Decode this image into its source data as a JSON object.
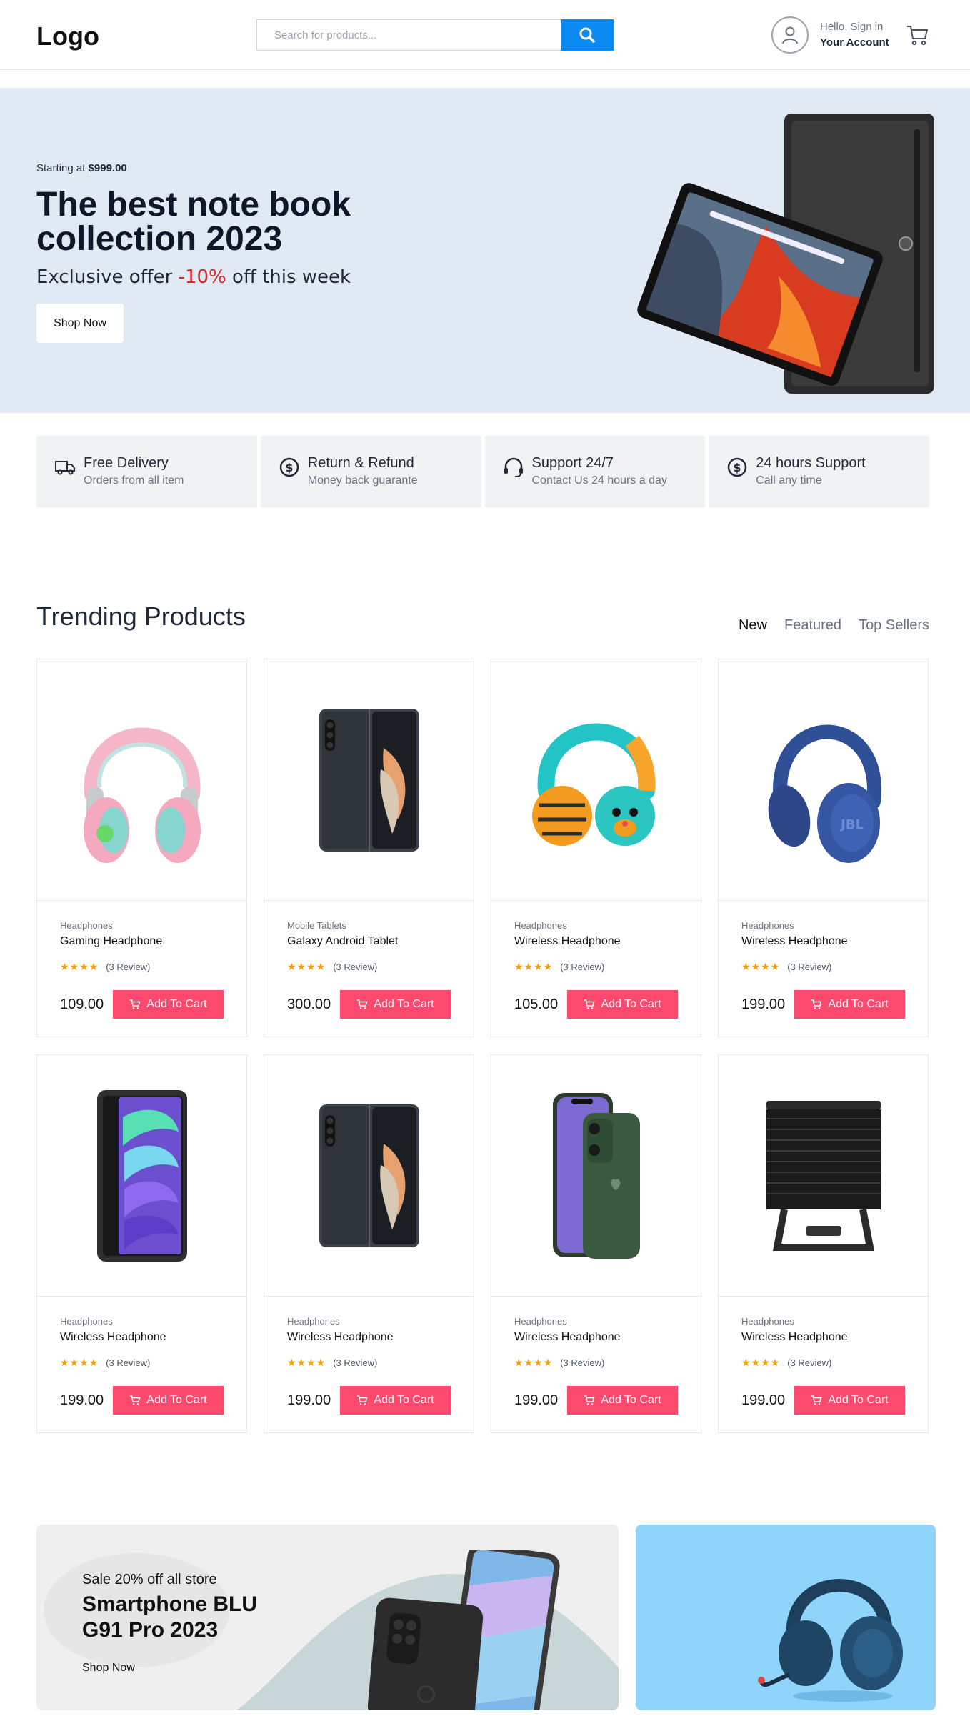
{
  "header": {
    "logo": "Logo",
    "search_placeholder": "Search for products...",
    "account_hello": "Hello, Sign in",
    "account_label": "Your Account"
  },
  "hero": {
    "starting_prefix": "Starting at ",
    "starting_price": "$999.00",
    "title_line1": "The best note book",
    "title_line2": "collection 2023",
    "offer_prefix": "Exclusive offer ",
    "offer_pct": "-10%",
    "offer_suffix": " off this week",
    "shop_label": "Shop Now"
  },
  "features": [
    {
      "title": "Free Delivery",
      "subtitle": "Orders from all item",
      "icon": "truck-icon"
    },
    {
      "title": "Return & Refund",
      "subtitle": "Money back guarante",
      "icon": "dollar-coin-icon"
    },
    {
      "title": "Support 24/7",
      "subtitle": "Contact Us 24 hours a day",
      "icon": "headset-icon"
    },
    {
      "title": "24 hours Support",
      "subtitle": "Call any time",
      "icon": "dollar-coin-icon"
    }
  ],
  "trending": {
    "title": "Trending Products",
    "tabs": [
      "New",
      "Featured",
      "Top Sellers"
    ],
    "active_tab": "New",
    "products": [
      {
        "category": "Headphones",
        "name": "Gaming Headphone",
        "reviews": "(3 Review)",
        "price": "109.00",
        "cart_label": "Add To Cart",
        "image": "pink-headphone"
      },
      {
        "category": "Mobile Tablets",
        "name": "Galaxy Android Tablet",
        "reviews": "(3 Review)",
        "price": "300.00",
        "cart_label": "Add To Cart",
        "image": "fold-phone"
      },
      {
        "category": "Headphones",
        "name": "Wireless Headphone",
        "reviews": "(3 Review)",
        "price": "105.00",
        "cart_label": "Add To Cart",
        "image": "kids-headphone"
      },
      {
        "category": "Headphones",
        "name": "Wireless Headphone",
        "reviews": "(3 Review)",
        "price": "199.00",
        "cart_label": "Add To Cart",
        "image": "blue-headphone"
      },
      {
        "category": "Headphones",
        "name": "Wireless Headphone",
        "reviews": "(3 Review)",
        "price": "199.00",
        "cart_label": "Add To Cart",
        "image": "ipad-mini"
      },
      {
        "category": "Headphones",
        "name": "Wireless Headphone",
        "reviews": "(3 Review)",
        "price": "199.00",
        "cart_label": "Add To Cart",
        "image": "fold-phone"
      },
      {
        "category": "Headphones",
        "name": "Wireless Headphone",
        "reviews": "(3 Review)",
        "price": "199.00",
        "cart_label": "Add To Cart",
        "image": "green-iphone"
      },
      {
        "category": "Headphones",
        "name": "Wireless Headphone",
        "reviews": "(3 Review)",
        "price": "199.00",
        "cart_label": "Add To Cart",
        "image": "cpu-cooler"
      }
    ]
  },
  "promo": {
    "sale": "Sale 20% off all store",
    "title_line1": "Smartphone BLU",
    "title_line2": "G91 Pro 2023",
    "shop_label": "Shop Now"
  },
  "colors": {
    "accent_blue": "#0b8af2",
    "cart_pink": "#fb4a6d",
    "hero_bg": "#e1eaf4",
    "star": "#f59e0b",
    "offer_red": "#dc2626"
  }
}
